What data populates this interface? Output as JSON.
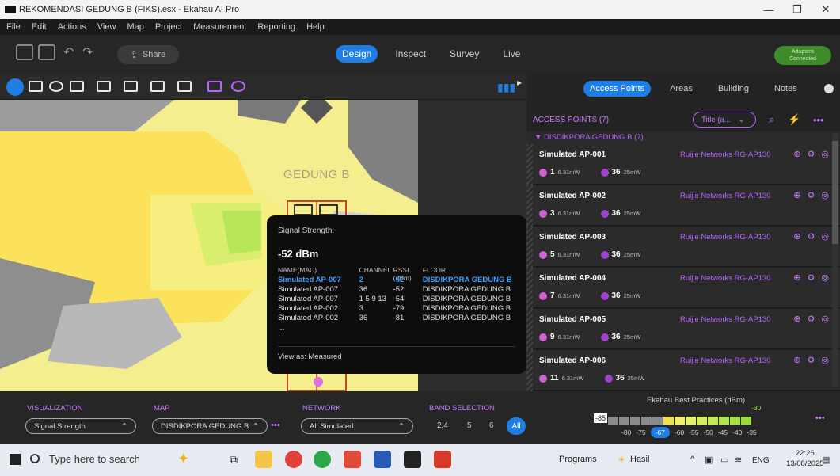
{
  "window": {
    "title": "REKOMENDASI GEDUNG B (FIKS).esx - Ekahau AI Pro"
  },
  "menu": [
    "File",
    "Edit",
    "Actions",
    "View",
    "Map",
    "Project",
    "Measurement",
    "Reporting",
    "Help"
  ],
  "toolbar": {
    "share_label": "Share",
    "modes": [
      "Design",
      "Inspect",
      "Survey",
      "Live"
    ],
    "active_mode": "Design",
    "adapters_line1": "Adapters",
    "adapters_line2": "Connected"
  },
  "map": {
    "building_label": "GEDUNG B",
    "tooltip": {
      "label": "Signal Strength:",
      "value": "-52 dBm",
      "headers": [
        "NAME(MAC)",
        "CHANNEL",
        "RSSI (dBm)",
        "FLOOR"
      ],
      "rows": [
        [
          "Simulated AP-007",
          "2",
          "-52",
          "DISDIKPORA GEDUNG B"
        ],
        [
          "Simulated AP-007",
          "36",
          "-52",
          "DISDIKPORA GEDUNG B"
        ],
        [
          "Simulated AP-007",
          "1 5 9 13",
          "-54",
          "DISDIKPORA GEDUNG B"
        ],
        [
          "Simulated AP-002",
          "3",
          "-79",
          "DISDIKPORA GEDUNG B"
        ],
        [
          "Simulated AP-002",
          "36",
          "-81",
          "DISDIKPORA GEDUNG B"
        ]
      ],
      "more": "...",
      "view_as": "View as: Measured"
    }
  },
  "panel": {
    "tabs": [
      "Access Points",
      "Areas",
      "Building",
      "Notes"
    ],
    "active_tab": "Access Points",
    "header": "ACCESS POINTS (7)",
    "sort_label": "Title (a...",
    "group": "▼  DISDIKPORA GEDUNG B (7)",
    "aps": [
      {
        "name": "Simulated AP-001",
        "model": "Ruijie Networks RG-AP130",
        "ch1": "1",
        "pw1": "6.31mW",
        "ch2": "36",
        "pw2": "25mW"
      },
      {
        "name": "Simulated AP-002",
        "model": "Ruijie Networks RG-AP130",
        "ch1": "3",
        "pw1": "6.31mW",
        "ch2": "36",
        "pw2": "25mW"
      },
      {
        "name": "Simulated AP-003",
        "model": "Ruijie Networks RG-AP130",
        "ch1": "5",
        "pw1": "6.31mW",
        "ch2": "36",
        "pw2": "25mW"
      },
      {
        "name": "Simulated AP-004",
        "model": "Ruijie Networks RG-AP130",
        "ch1": "7",
        "pw1": "6.31mW",
        "ch2": "36",
        "pw2": "25mW"
      },
      {
        "name": "Simulated AP-005",
        "model": "Ruijie Networks RG-AP130",
        "ch1": "9",
        "pw1": "6.31mW",
        "ch2": "36",
        "pw2": "25mW"
      },
      {
        "name": "Simulated AP-006",
        "model": "Ruijie Networks RG-AP130",
        "ch1": "11",
        "pw1": "6.31mW",
        "ch2": "36",
        "pw2": "25mW"
      }
    ]
  },
  "bottom": {
    "visualization_label": "VISUALIZATION",
    "visualization_value": "Signal Strength",
    "map_label": "MAP",
    "map_value": "DISDIKPORA GEDUNG B",
    "network_label": "NETWORK",
    "network_value": "All Simulated",
    "band_label": "BAND SELECTION",
    "bands": [
      "2.4",
      "5",
      "6"
    ],
    "band_all": "All",
    "legend_title": "Ekahau Best Practices (dBm)",
    "legend_min": "-85",
    "legend_max": "-30",
    "legend_ticks": [
      "-80",
      "-75",
      "-67",
      "-60",
      "-55",
      "-50",
      "-45",
      "-40",
      "-35"
    ],
    "legend_selected": "-67"
  },
  "taskbar": {
    "search": "Type here to search",
    "programs": "Programs",
    "hasil": "Hasil",
    "lang": "ENG",
    "time": "22:26",
    "date": "13/08/2025"
  },
  "colors": {
    "accent": "#1e7ee4",
    "purple": "#c77dff",
    "green": "#3f8a2a",
    "map_yellow": "#f8f4a6"
  }
}
